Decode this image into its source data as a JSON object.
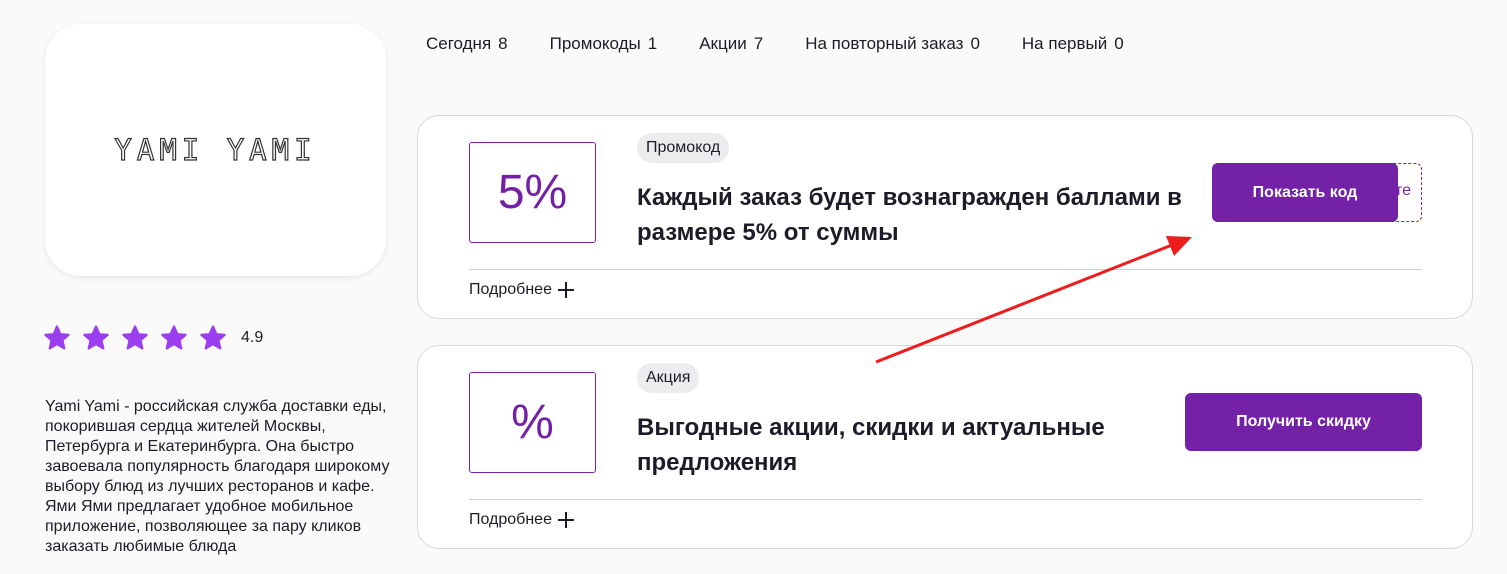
{
  "brand": {
    "logo_text": "YAMI YAMI"
  },
  "rating": {
    "value": "4.9",
    "stars": 5,
    "star_color": "#9b3ef0"
  },
  "description": "Yami Yami - российская служба доставки еды, покорившая сердца жителей Москвы, Петербурга и Екатеринбурга. Она быстро завоевала популярность благодаря широкому выбору блюд из лучших ресторанов и кафе. Ями Ями предлагает удобное мобильное приложение, позволяющее за пару кликов заказать любимые блюда",
  "tabs": [
    {
      "label": "Сегодня",
      "count": "8"
    },
    {
      "label": "Промокоды",
      "count": "1"
    },
    {
      "label": "Акции",
      "count": "7"
    },
    {
      "label": "На повторный заказ",
      "count": "0"
    },
    {
      "label": "На первый",
      "count": "0"
    }
  ],
  "offers": [
    {
      "value": "5%",
      "badge": "Промокод",
      "title": "Каждый заказ будет вознагражден баллами в размере 5% от суммы",
      "details": "Подробнее",
      "button": "Показать код",
      "code_peek": "те"
    },
    {
      "value": "%",
      "badge": "Акция",
      "title": "Выгодные акции, скидки и актуальные предложения",
      "details": "Подробнее",
      "button": "Получить скидку"
    }
  ],
  "colors": {
    "accent": "#7321a6",
    "annotation_arrow": "#ee1c1c"
  }
}
